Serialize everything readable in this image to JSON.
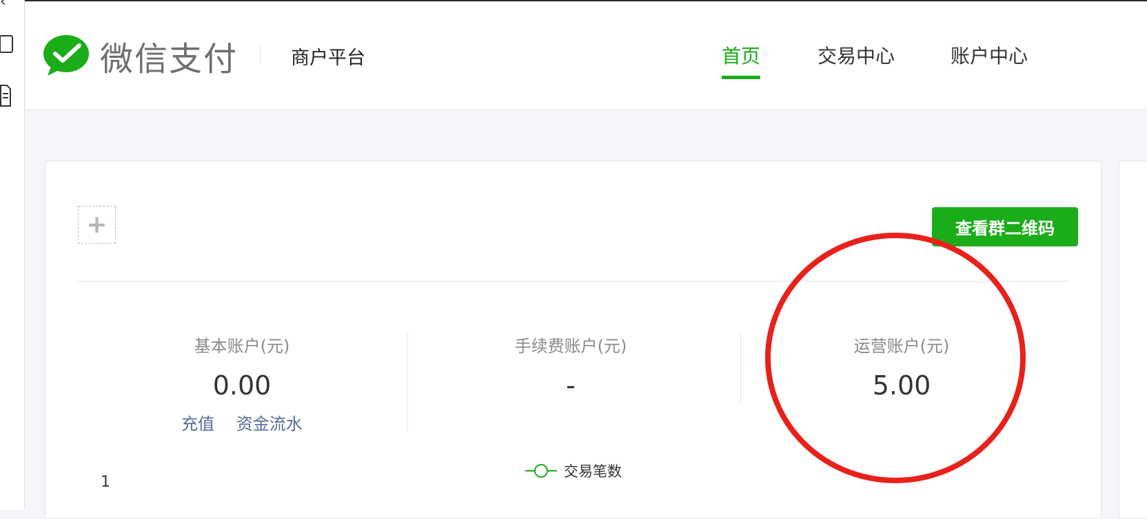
{
  "os_sidebar": {
    "icons": [
      "chevron-left-icon",
      "window-icon",
      "document-icon"
    ]
  },
  "header": {
    "brand": "微信支付",
    "platform": "商户平台",
    "nav": [
      {
        "label": "首页",
        "active": true
      },
      {
        "label": "交易中心",
        "active": false
      },
      {
        "label": "账户中心",
        "active": false
      }
    ],
    "accent_color": "#1aad19"
  },
  "toolbar": {
    "add_label": "+",
    "qr_button_label": "查看群二维码"
  },
  "accounts": [
    {
      "label": "基本账户(元)",
      "value": "0.00",
      "links": [
        "充值",
        "资金流水"
      ]
    },
    {
      "label": "手续费账户(元)",
      "value": "-"
    },
    {
      "label": "运营账户(元)",
      "value": "5.00"
    }
  ],
  "chart": {
    "legend": "交易笔数",
    "axis_fragment": "1"
  },
  "annotation": {
    "color": "#e8221b",
    "target": "运营账户(元)"
  }
}
